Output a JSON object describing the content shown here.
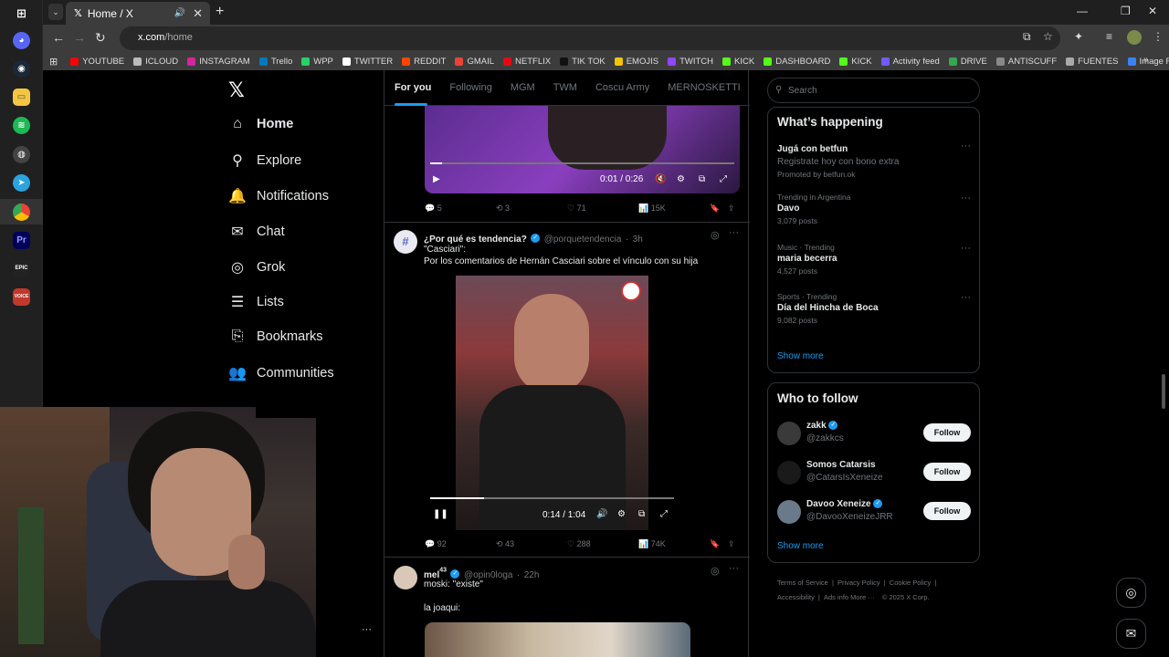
{
  "browser": {
    "tab_title": "Home / X",
    "url_domain": "x.com",
    "url_path": "/home",
    "bookmarks": [
      {
        "label": "YOUTUBE",
        "color": "#ff0000"
      },
      {
        "label": "ICLOUD",
        "color": "#bbbbbb"
      },
      {
        "label": "INSTAGRAM",
        "color": "#d6249f"
      },
      {
        "label": "Trello",
        "color": "#0079bf"
      },
      {
        "label": "WPP",
        "color": "#25d366"
      },
      {
        "label": "TWITTER",
        "color": "#ffffff"
      },
      {
        "label": "REDDIT",
        "color": "#ff4500"
      },
      {
        "label": "GMAIL",
        "color": "#ea4335"
      },
      {
        "label": "NETFLIX",
        "color": "#e50914"
      },
      {
        "label": "TIK TOK",
        "color": "#111111"
      },
      {
        "label": "EMOJIS",
        "color": "#f5c400"
      },
      {
        "label": "TWITCH",
        "color": "#9146ff"
      },
      {
        "label": "KICK",
        "color": "#53fc18"
      },
      {
        "label": "DASHBOARD",
        "color": "#53fc18"
      },
      {
        "label": "KICK",
        "color": "#53fc18"
      },
      {
        "label": "Activity feed",
        "color": "#6f5cff"
      },
      {
        "label": "DRIVE",
        "color": "#34a853"
      },
      {
        "label": "ANTISCUFF",
        "color": "#888888"
      },
      {
        "label": "FUENTES",
        "color": "#aaaaaa"
      },
      {
        "label": "Image Resizer | Resi...",
        "color": "#3b82f6"
      }
    ]
  },
  "x": {
    "nav": [
      {
        "label": "Home",
        "icon": "home-icon",
        "glyph": "⌂"
      },
      {
        "label": "Explore",
        "icon": "search-icon",
        "glyph": "⚲"
      },
      {
        "label": "Notifications",
        "icon": "bell-icon",
        "glyph": "🔔"
      },
      {
        "label": "Chat",
        "icon": "mail-icon",
        "glyph": "✉"
      },
      {
        "label": "Grok",
        "icon": "grok-icon",
        "glyph": "◎"
      },
      {
        "label": "Lists",
        "icon": "list-icon",
        "glyph": "☰"
      },
      {
        "label": "Bookmarks",
        "icon": "bookmark-icon",
        "glyph": "⎘"
      },
      {
        "label": "Communities",
        "icon": "communities-icon",
        "glyph": "👥"
      }
    ],
    "feed_tabs": [
      "For you",
      "Following",
      "MGM",
      "TWM",
      "Coscu Army",
      "MERNOSKETTI",
      "S"
    ],
    "tweet1": {
      "time": "0:01 / 0:26",
      "replies": "5",
      "reposts": "3",
      "likes": "71",
      "views": "15K",
      "progress": 0.04
    },
    "tweet2": {
      "name": "¿Por qué es tendencia?",
      "handle": "@porquetendencia",
      "age": "3h",
      "line1": "\"Casciari\":",
      "line2": "Por los comentarios de Hernán Casciari sobre el vínculo con su hija",
      "time": "0:14 / 1:04",
      "progress": 0.22,
      "replies": "92",
      "reposts": "43",
      "likes": "288",
      "views": "74K"
    },
    "tweet3": {
      "name": "mel",
      "sup": "43",
      "handle": "@opin0loga",
      "age": "22h",
      "line1": "moski: \"existe\"",
      "line2": "la joaqui:"
    },
    "search_placeholder": "Search",
    "happening": {
      "title": "What’s happening",
      "items": [
        {
          "meta": "",
          "title": "Jugá con betfun",
          "sub": "Registrate hoy con bono extra",
          "extra": "Promoted by betfun.ok"
        },
        {
          "meta": "Trending in Argentina",
          "title": "Davo",
          "sub": "3,079 posts",
          "extra": ""
        },
        {
          "meta": "Music · Trending",
          "title": "maria becerra",
          "sub": "4,527 posts",
          "extra": ""
        },
        {
          "meta": "Sports · Trending",
          "title": "Día del Hincha de Boca",
          "sub": "9,082 posts",
          "extra": ""
        }
      ],
      "show_more": "Show more"
    },
    "follow": {
      "title": "Who to follow",
      "items": [
        {
          "name": "zakk",
          "handle": "@zakkcs",
          "button": "Follow"
        },
        {
          "name": "Somos Catarsis",
          "handle": "@CatarsIsXeneize",
          "button": "Follow"
        },
        {
          "name": "Davoo Xeneize",
          "handle": "@DavooXeneizeJRR",
          "button": "Follow"
        }
      ],
      "show_more": "Show more"
    },
    "footer": {
      "links": [
        "Terms of Service",
        "Privacy Policy",
        "Cookie Policy",
        "Accessibility",
        "Ads info",
        "More ···"
      ],
      "copyright": "© 2025 X Corp."
    }
  }
}
